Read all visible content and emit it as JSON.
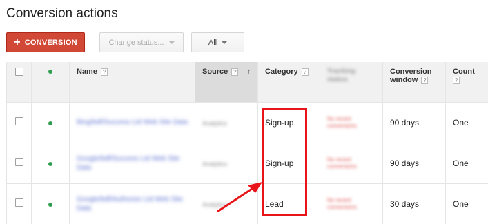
{
  "page": {
    "title": "Conversion actions"
  },
  "toolbar": {
    "add_label": "CONVERSION",
    "status_label": "Change status...",
    "filter_label": "All"
  },
  "table": {
    "headers": {
      "name": "Name",
      "source": "Source",
      "category": "Category",
      "tracking": "Tracking status",
      "window": "Conversion window",
      "count": "Count"
    },
    "rows": [
      {
        "name": "Bing/bdf/Success Ltd Web Site Data",
        "source": "Analytics",
        "category": "Sign-up",
        "tracking": "No recent conversions",
        "window": "90 days",
        "count": "One"
      },
      {
        "name": "Google/bdf/Success Ltd Web Site Data",
        "source": "Analytics",
        "category": "Sign-up",
        "tracking": "No recent conversions",
        "window": "90 days",
        "count": "One"
      },
      {
        "name": "Google/bdf/Authorize Ltd Web Site Data",
        "source": "Analytics",
        "category": "Lead",
        "tracking": "No recent conversions",
        "window": "30 days",
        "count": "One"
      }
    ]
  },
  "colors": {
    "primary_button": "#d14836",
    "highlight": "#e8141a",
    "status_dot": "#2e9e4f"
  },
  "icons": {
    "add": "plus-icon",
    "caret": "caret-down-icon",
    "help": "help-icon",
    "sort": "sort-arrow-up-icon"
  }
}
